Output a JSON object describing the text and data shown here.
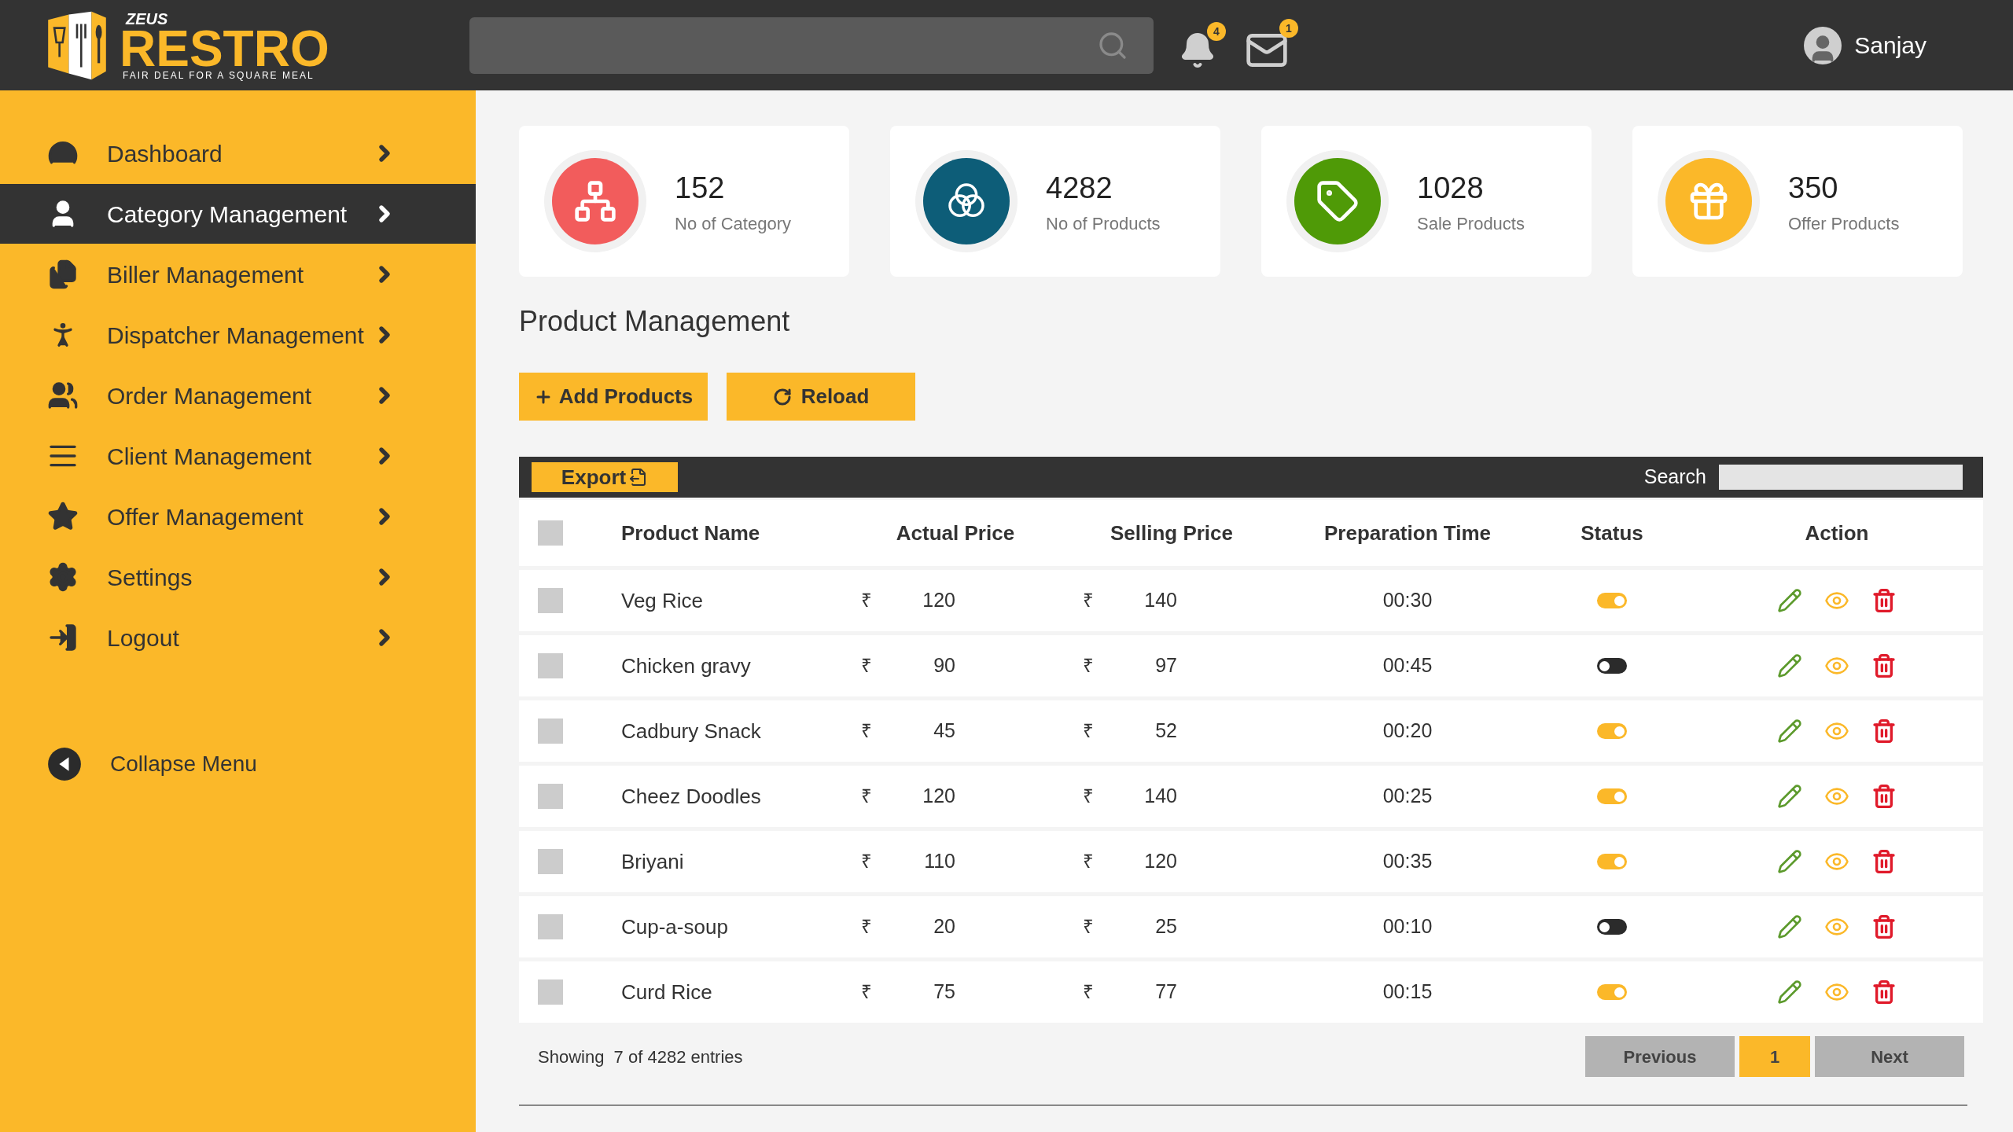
{
  "header": {
    "logo": {
      "top": "ZEUS",
      "name": "RESTRO",
      "tagline": "FAIR DEAL FOR A SQUARE MEAL"
    },
    "notifications": {
      "count": "4"
    },
    "messages": {
      "count": "1"
    },
    "user": {
      "name": "Sanjay"
    }
  },
  "sidebar": {
    "items": [
      {
        "label": "Dashboard",
        "selected": false
      },
      {
        "label": "Category Management",
        "selected": true
      },
      {
        "label": "Biller Management",
        "selected": false
      },
      {
        "label": "Dispatcher Management",
        "selected": false
      },
      {
        "label": "Order Management",
        "selected": false
      },
      {
        "label": "Client Management",
        "selected": false
      },
      {
        "label": "Offer Management",
        "selected": false
      },
      {
        "label": "Settings",
        "selected": false
      },
      {
        "label": "Logout",
        "selected": false
      }
    ],
    "collapse": "Collapse Menu"
  },
  "stats": [
    {
      "value": "152",
      "label": "No of Category",
      "color": "#f25c5c"
    },
    {
      "value": "4282",
      "label": "No of Products",
      "color": "#0d5d78"
    },
    {
      "value": "1028",
      "label": "Sale Products",
      "color": "#4f9a07"
    },
    {
      "value": "350",
      "label": "Offer Products",
      "color": "#fbb829"
    }
  ],
  "title": "Product Management",
  "actions": [
    "Add Products",
    "Reload"
  ],
  "table": {
    "export": "Export",
    "search_label": "Search",
    "header_checked": false,
    "columns": [
      "Product Name",
      "Actual Price",
      "Selling Price",
      "Preparation Time",
      "Status",
      "Action"
    ],
    "rows": [
      {
        "checked": false,
        "name": "Veg Rice",
        "actual_currency": "₹",
        "actual": "120",
        "selling_currency": "₹",
        "selling": "140",
        "time": "00:30",
        "on": true
      },
      {
        "checked": false,
        "name": "Chicken gravy",
        "actual_currency": "₹",
        "actual": "90",
        "selling_currency": "₹",
        "selling": "97",
        "time": "00:45",
        "on": false
      },
      {
        "checked": false,
        "name": "Cadbury Snack",
        "actual_currency": "₹",
        "actual": "45",
        "selling_currency": "₹",
        "selling": "52",
        "time": "00:20",
        "on": true
      },
      {
        "checked": false,
        "name": "Cheez Doodles",
        "actual_currency": "₹",
        "actual": "120",
        "selling_currency": "₹",
        "selling": "140",
        "time": "00:25",
        "on": true
      },
      {
        "checked": false,
        "name": "Briyani",
        "actual_currency": "₹",
        "actual": "110",
        "selling_currency": "₹",
        "selling": "120",
        "time": "00:35",
        "on": true
      },
      {
        "checked": false,
        "name": "Cup-a-soup",
        "actual_currency": "₹",
        "actual": "20",
        "selling_currency": "₹",
        "selling": "25",
        "time": "00:10",
        "on": false
      },
      {
        "checked": false,
        "name": "Curd Rice",
        "actual_currency": "₹",
        "actual": "75",
        "selling_currency": "₹",
        "selling": "77",
        "time": "00:15",
        "on": true
      }
    ],
    "footer": "Showing  7 of 4282 entries",
    "pagination": {
      "previous": "Previous",
      "pages": [
        {
          "label": "1",
          "selected": true
        }
      ],
      "next": "Next"
    }
  }
}
